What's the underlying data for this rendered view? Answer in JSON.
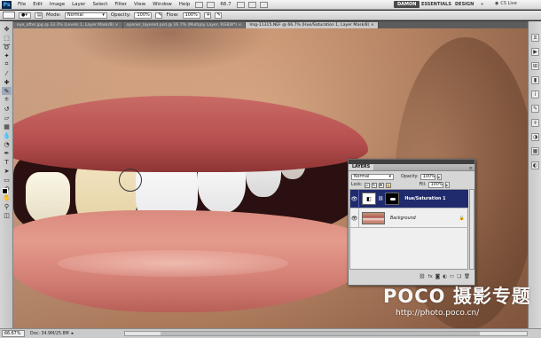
{
  "menubar": {
    "logo": "Ps",
    "items": [
      "File",
      "Edit",
      "Image",
      "Layer",
      "Select",
      "Filter",
      "View",
      "Window",
      "Help"
    ],
    "zoom_indicator": "66.7",
    "workspaces": [
      "DAMON",
      "ESSENTIALS",
      "DESIGN"
    ],
    "more": "»",
    "cs_live": "CS Live",
    "window_controls": [
      "−",
      "▫",
      "×"
    ]
  },
  "options": {
    "mode_label": "Mode:",
    "mode_value": "Normal",
    "opacity_label": "Opacity:",
    "opacity_value": "100%",
    "flow_label": "Flow:",
    "flow_value": "100%"
  },
  "tabs": [
    {
      "label": "eye_after.jpg @ 33.3% (Levels 1, Layer Mask/8) ×",
      "active": false
    },
    {
      "label": "opener_layered.psd @ 16.7% (Multiply Layer, RGB/8*) ×",
      "active": false
    },
    {
      "label": "Img-11315.NEF @ 66.7% (Hue/Saturation 1, Layer Mask/8) ×",
      "active": true
    }
  ],
  "layers_panel": {
    "tab_label": "LAYERS",
    "menu_icon": "≡",
    "blend_mode": "Normal",
    "opacity_label": "Opacity:",
    "opacity_value": "100%",
    "lock_label": "Lock:",
    "fill_label": "Fill:",
    "fill_value": "100%",
    "layers": [
      {
        "name": "Hue/Saturation 1",
        "selected": true
      },
      {
        "name": "Background",
        "selected": false
      }
    ],
    "footer_icons": [
      "link-icon",
      "fx-icon",
      "mask-icon",
      "adjustment-icon",
      "folder-icon",
      "new-layer-icon",
      "trash-icon"
    ],
    "footer_glyphs": [
      "⛓",
      "fx",
      "◙",
      "◐",
      "▭",
      "❏",
      "🗑"
    ]
  },
  "status": {
    "zoom": "66.67%",
    "doc": "Doc: 34.9M/25.8M",
    "arrow": "▸"
  },
  "watermark": {
    "brand": "POCO 摄影专题",
    "url": "http://photo.poco.cn/"
  },
  "colors": {
    "selected_layer": "#202b6e",
    "panel_bg": "#d6d6d6",
    "tab_active": "#c9c9c9"
  }
}
